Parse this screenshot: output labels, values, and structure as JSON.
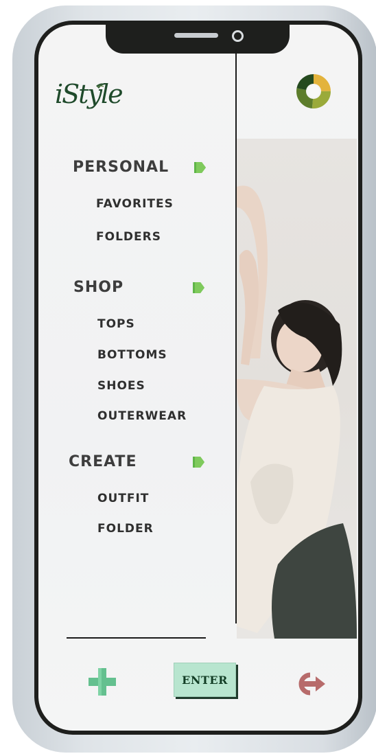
{
  "app": {
    "logo_text": "iStyle"
  },
  "menu": {
    "sections": [
      {
        "title": "PERSONAL",
        "items": [
          "FAVORITES",
          "FOLDERS"
        ]
      },
      {
        "title": "SHOP",
        "items": [
          "TOPS",
          "BOTTOMS",
          "SHOES",
          "OUTERWEAR"
        ]
      },
      {
        "title": "CREATE",
        "items": [
          "OUTFIT",
          "FOLDER"
        ]
      }
    ]
  },
  "footer": {
    "enter_label": "ENTER"
  },
  "icons": {
    "add": "plus-icon",
    "logout": "logout-icon",
    "section_arrow": "chevron-right-icon",
    "profile": "ring-avatar-icon"
  },
  "colors": {
    "accent_green": "#5fb548",
    "dark_green": "#1f4a2b",
    "enter_bg": "#b8e5cf",
    "logout_color": "#b76b6b",
    "plus_color": "#64c08f"
  }
}
